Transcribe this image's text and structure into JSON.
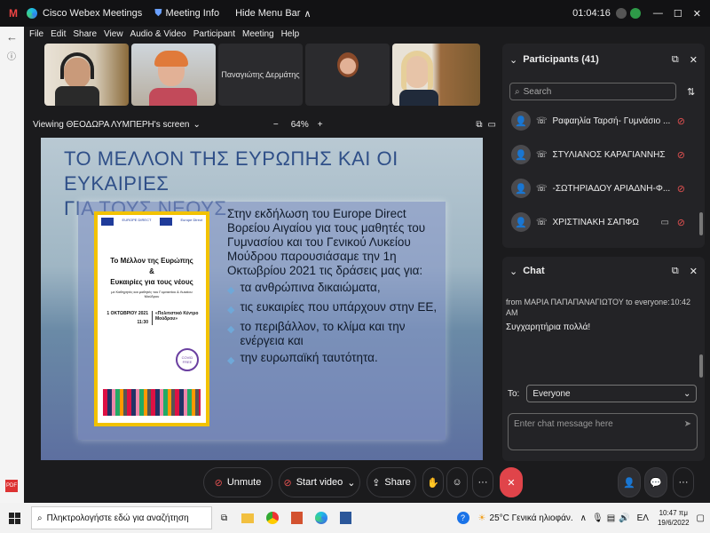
{
  "titlebar": {
    "app": "Cisco Webex Meetings",
    "meeting_info": "Meeting Info",
    "hide_menu": "Hide Menu Bar",
    "timer": "01:04:16"
  },
  "menu": [
    "File",
    "Edit",
    "Share",
    "View",
    "Audio & Video",
    "Participant",
    "Meeting",
    "Help"
  ],
  "thumbnails": {
    "named": "Παναγιώτης Δερμάτης"
  },
  "viewbar": {
    "viewing": "Viewing ΘΕΟΔΩΡΑ ΛΥΜΠΕΡΗ's screen",
    "zoom_minus": "−",
    "zoom": "64%",
    "zoom_plus": "+"
  },
  "slide": {
    "title_line1": "ΤΟ ΜΕΛΛΟΝ ΤΗΣ ΕΥΡΩΠΗΣ ΚΑΙ ΟΙ ΕΥΚΑΙΡΙΕΣ",
    "title_line2": "ΓΙΑ ΤΟΥΣ ΝΕΟΥΣ",
    "intro": "Στην εκδήλωση του Europe Direct Βορείου Αιγαίου για τους μαθητές του Γυμνασίου και του Γενικού Λυκείου Μούδρου παρουσιάσαμε την 1η Οκτωβρίου 2021 τις δράσεις μας για:",
    "bullets": [
      "τα ανθρώπινα δικαιώματα,",
      "τις ευκαιρίες που υπάρχουν στην ΕΕ,",
      "το περιβάλλον, το κλίμα και την ενέργεια και",
      "την ευρωπαϊκή ταυτότητα."
    ],
    "poster": {
      "brand_left": "EUROPE DIRECT",
      "brand_right": "Europe Direct",
      "title": "Το Μέλλον της Ευρώπης",
      "amp": "&",
      "subtitle": "Ευκαιρίες για τους νέους",
      "small": "με Καθηγητές και μαθητές του Γυμνασίου & Λυκείου Μούδρου",
      "date": "1 ΟΚΤΩΒΡΙΟΥ 2021",
      "time": "11:30",
      "venue": "«Πολιτιστικό Κέντρο Μούδρου»",
      "badge": "COVID FREE"
    }
  },
  "participants": {
    "title": "Participants (41)",
    "search_placeholder": "Search",
    "list": [
      "Ραφαηλία Ταρσή- Γυμνάσιο ...",
      "ΣΤΥΛΙΑΝΟΣ ΚΑΡΑΓΙΑΝΝΗΣ",
      "-ΣΩΤΗΡΙΑΔΟΥ ΑΡΙΑΔΝΗ-Φ...",
      "ΧΡΙΣΤΙΝΑΚΗ ΣΑΠΦΩ"
    ]
  },
  "chat": {
    "title": "Chat",
    "from": "from ΜΑΡΙΑ ΠΑΠΑΠΑΝΑΓΙΩΤΟΥ to everyone:",
    "time": "10:42",
    "ampm": "AM",
    "message": "Συγχαρητήρια πολλά!",
    "to_label": "To:",
    "to_value": "Everyone",
    "input_placeholder": "Enter chat message here"
  },
  "controls": {
    "unmute": "Unmute",
    "start_video": "Start video",
    "share": "Share"
  },
  "taskbar": {
    "search": "Πληκτρολογήστε εδώ για αναζήτηση",
    "weather": "25°C Γενικά ηλιοφάν.",
    "lang": "ΕΛ",
    "time": "10:47 πμ",
    "date": "19/6/2022"
  },
  "colors": {
    "accent": "#e0444a",
    "slide_title": "#2f4f88"
  }
}
